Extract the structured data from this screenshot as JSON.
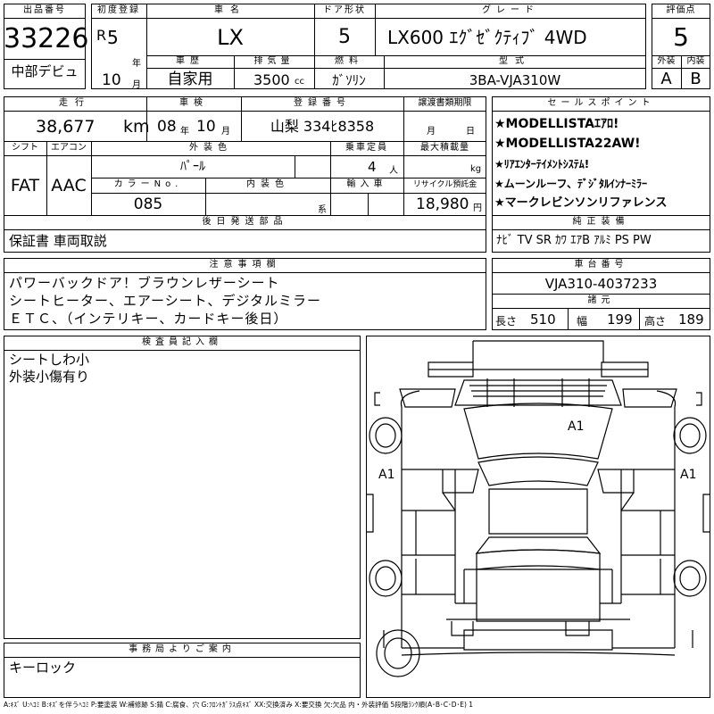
{
  "lot": {
    "label": "出品番号",
    "number": "33226",
    "debut": "中部デビュ"
  },
  "first_reg": {
    "label": "初度登録",
    "era": "R",
    "year": "5",
    "year_unit": "年",
    "month": "10",
    "month_unit": "月"
  },
  "car_name": {
    "label": "車名",
    "value": "LX"
  },
  "doors": {
    "label": "ドア形状",
    "value": "5"
  },
  "grade": {
    "label": "グレード",
    "value": "LX600 ｴｸﾞｾﾞｸﾃｨﾌﾞ 4WD"
  },
  "score": {
    "label": "評価点",
    "value": "5",
    "ext_label": "外装",
    "ext_value": "A",
    "int_label": "内装",
    "int_value": "B"
  },
  "history": {
    "label": "車歴",
    "value": "自家用"
  },
  "displacement": {
    "label": "排気量",
    "value": "3500",
    "unit": "cc"
  },
  "fuel": {
    "label": "燃料",
    "value": "ｶﾞｿﾘﾝ"
  },
  "model_code": {
    "label": "型式",
    "value": "3BA-VJA310W"
  },
  "mileage": {
    "label": "走行",
    "value": "38,677",
    "unit": "km"
  },
  "inspection": {
    "label": "車検",
    "year": "08",
    "year_unit": "年",
    "month": "10",
    "month_unit": "月"
  },
  "reg_number": {
    "label": "登録番号",
    "value": "山梨 334ﾋ8358"
  },
  "transfer_doc": {
    "label": "譲渡書類期限",
    "month_unit": "月",
    "day_unit": "日"
  },
  "sales_points": {
    "label": "セールスポイント",
    "items": [
      "★MODELLISTAｴｱﾛ!",
      "★MODELLISTA22AW!",
      "★ﾘｱｴﾝﾀｰﾃｲﾒﾝﾄｼｽﾃﾑ!",
      "★ムーンルーフ、ﾃﾞｼﾞﾀﾙｲﾝﾅｰﾐﾗｰ",
      "★マークレビンソンリファレンス"
    ]
  },
  "shift": {
    "label": "シフト",
    "value": "FAT"
  },
  "aircon": {
    "label": "エアコン",
    "value": "AAC"
  },
  "ext_color": {
    "label": "外装色",
    "value": "ﾊﾟｰﾙ"
  },
  "capacity": {
    "label": "乗車定員",
    "value": "4",
    "unit": "人"
  },
  "max_load": {
    "label": "最大積載量",
    "unit": "kg"
  },
  "color_no": {
    "label": "カラーNo.",
    "value": "085"
  },
  "int_color": {
    "label": "内装色",
    "unit": "系"
  },
  "import": {
    "label": "輸入車"
  },
  "recycle": {
    "label": "リサイクル預託金",
    "value": "18,980",
    "unit": "円"
  },
  "later_parts": {
    "label": "後日発送部品",
    "value": "保証書 車両取説"
  },
  "equipment": {
    "label": "純正装備",
    "value": "ﾅﾋﾞ TV SR ｶﾜ ｴｱB ｱﾙﾐ PS PW"
  },
  "notes": {
    "label": "注意事項欄",
    "lines": [
      "パワーバックドア！ブラウンレザーシート",
      "シートヒーター、エアーシート、デジタルミラー",
      "ＥＴＣ、（インテリキー、カードキー後日）"
    ]
  },
  "chassis": {
    "label": "車台番号",
    "value": "VJA310-4037233"
  },
  "dimensions": {
    "label": "諸元",
    "length_label": "長さ",
    "length": "510",
    "width_label": "幅",
    "width": "199",
    "height_label": "高さ",
    "height": "189"
  },
  "inspector": {
    "label": "検査員記入欄",
    "lines": [
      "シートしわ小",
      "外装小傷有り"
    ]
  },
  "office": {
    "label": "事務局よりご案内",
    "value": "キーロック"
  },
  "diagram": {
    "marks": [
      "A1",
      "A1",
      "A1"
    ]
  },
  "legend": "A:ｷｽﾞ U:ﾍｺﾐ B:ｷｽﾞを伴うﾍｺﾐ P:要塗装 W:補修跡 S:錆 C:腐食、穴 G:ﾌﾛﾝﾄｶﾞﾗｽ点ｷｽﾞ XX:交換済み X:要交換 欠:欠品 内・外装評価 5段階ﾗﾝｸ順(A･B･C･D･E) 1"
}
